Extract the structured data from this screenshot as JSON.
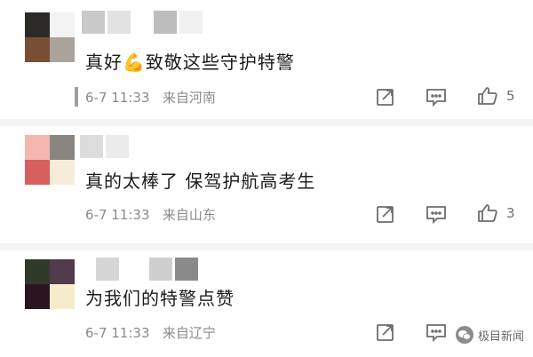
{
  "comments": [
    {
      "text": "真好💪致敬这些守护特警",
      "time": "6-7 11:33",
      "location": "来自河南",
      "likes": "5",
      "avatar_colors": [
        "#2c2a27",
        "#f3f3f3",
        "#7a4e35",
        "#a9a39b"
      ],
      "nick_colors": [
        "#c9c9c9",
        "#e2e2e2",
        "#bdbdbd",
        "#f0f0f0"
      ]
    },
    {
      "text": "真的太棒了 保驾护航高考生",
      "time": "6-7 11:33",
      "location": "来自山东",
      "likes": "3",
      "avatar_colors": [
        "#f3b7b0",
        "#8a8480",
        "#d65f60",
        "#f5ecd9"
      ],
      "nick_colors": [
        "#dcdcdc",
        "#ececec"
      ]
    },
    {
      "text": "为我们的特警点赞",
      "time": "6-7 11:33",
      "location": "来自辽宁",
      "likes": "",
      "avatar_colors": [
        "#31392a",
        "#523a4d",
        "#2a1620",
        "#f4eccb"
      ],
      "nick_colors": [
        "#d6d6d6",
        "#cfcfcf",
        "#8a8a8a"
      ]
    }
  ],
  "watermark": {
    "text": "极目新闻"
  },
  "icons": {
    "repost": "repost-icon",
    "comment": "comment-icon",
    "like": "like-icon"
  }
}
